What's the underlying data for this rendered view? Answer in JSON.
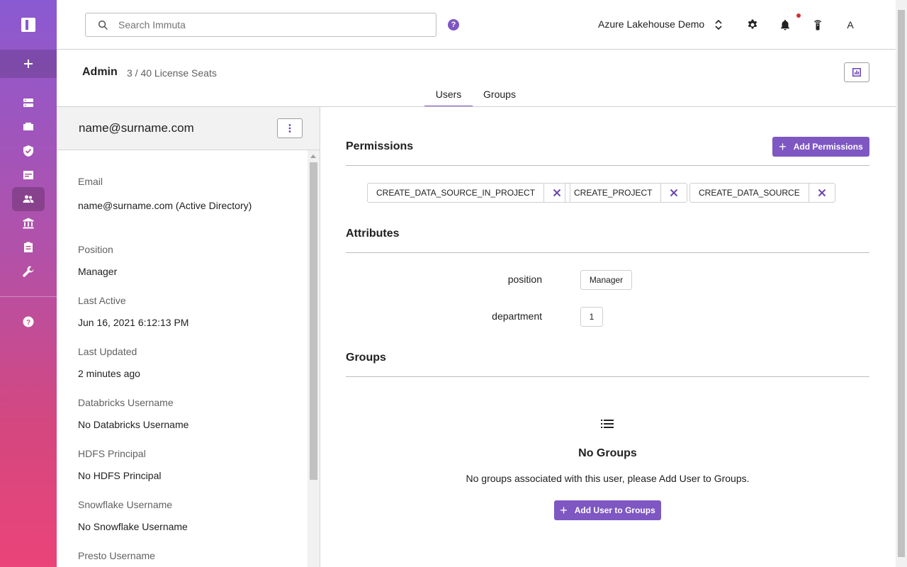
{
  "search": {
    "placeholder": "Search Immuta"
  },
  "topbar": {
    "help": "?",
    "tenant_name": "Azure Lakehouse Demo",
    "avatar_initial": "A",
    "has_notification": true
  },
  "header": {
    "title": "Admin",
    "license_seats": "3 / 40 License Seats"
  },
  "tabs": [
    {
      "label": "Users",
      "active": true
    },
    {
      "label": "Groups",
      "active": false
    }
  ],
  "user": {
    "name": "name@surname.com",
    "fields": [
      {
        "label": "Email",
        "value": "name@surname.com (Active Directory)"
      },
      {
        "label": "Position",
        "value": "Manager"
      },
      {
        "label": "Last Active",
        "value": "Jun 16, 2021 6:12:13 PM"
      },
      {
        "label": "Last Updated",
        "value": "2 minutes ago"
      },
      {
        "label": "Databricks Username",
        "value": "No Databricks Username"
      },
      {
        "label": "HDFS Principal",
        "value": "No HDFS Principal"
      },
      {
        "label": "Snowflake Username",
        "value": "No Snowflake Username"
      },
      {
        "label": "Presto Username",
        "value": ""
      }
    ]
  },
  "permissions": {
    "title": "Permissions",
    "add_label": "Add Permissions",
    "items": [
      "CREATE_DATA_SOURCE_IN_PROJECT",
      "CREATE_PROJECT",
      "CREATE_DATA_SOURCE"
    ]
  },
  "attributes": {
    "title": "Attributes",
    "items": [
      {
        "key": "position",
        "value": "Manager"
      },
      {
        "key": "department",
        "value": "1"
      }
    ]
  },
  "groups": {
    "title": "Groups",
    "empty_title": "No Groups",
    "empty_message": "No groups associated with this user, please Add User to Groups.",
    "add_label": "Add User to Groups"
  },
  "colors": {
    "accent": "#7e57c2",
    "sidebar_top": "#8a5ad2",
    "sidebar_bottom": "#ea4479",
    "notification": "#d32f2f"
  },
  "sidebar": {
    "icons": [
      "app-logo-icon",
      "plus-icon",
      "data-sources-icon",
      "projects-icon",
      "policies-icon",
      "query-editor-icon",
      "people-icon",
      "governance-icon",
      "audit-icon",
      "tools-icon",
      "help-icon"
    ],
    "active": "people-icon"
  }
}
